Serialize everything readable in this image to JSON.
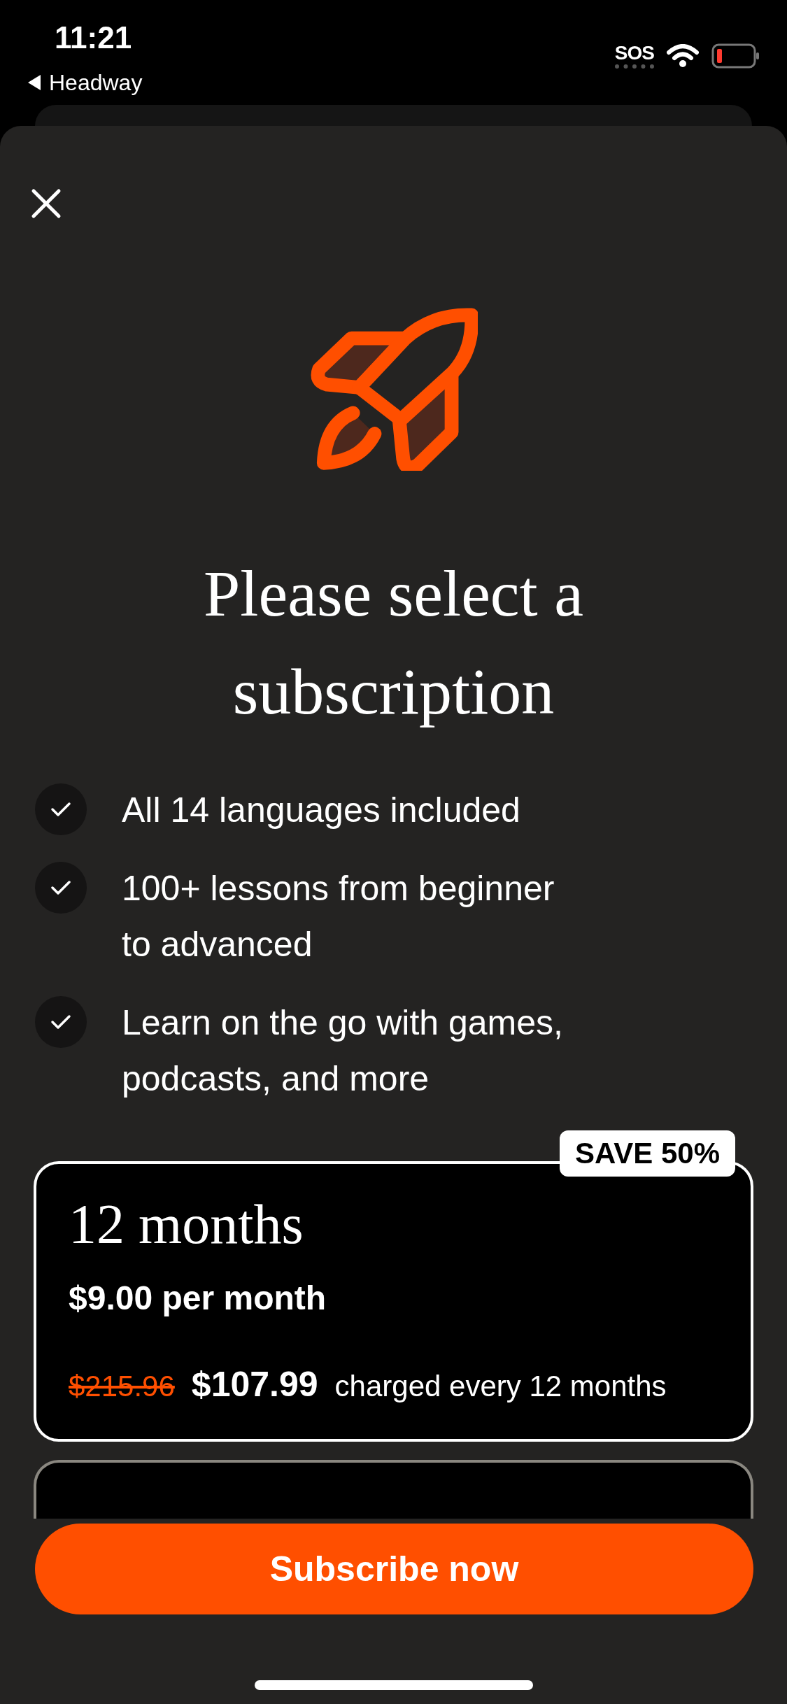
{
  "status_bar": {
    "time": "11:21",
    "back_label": "Headway",
    "sos": "SOS"
  },
  "title": "Please select a subscription",
  "features": [
    {
      "text": "All 14 languages included"
    },
    {
      "text": "100+ lessons from beginner to advanced"
    },
    {
      "text": "Learn on the go with games, podcasts, and more"
    }
  ],
  "plans": [
    {
      "duration": "12 months",
      "per_month": "$9.00 per month",
      "old_price": "$215.96",
      "price": "$107.99",
      "billing": "charged every 12 months",
      "badge": "SAVE 50%",
      "selected": true
    },
    {
      "selected": false
    }
  ],
  "subscribe_button": "Subscribe now"
}
